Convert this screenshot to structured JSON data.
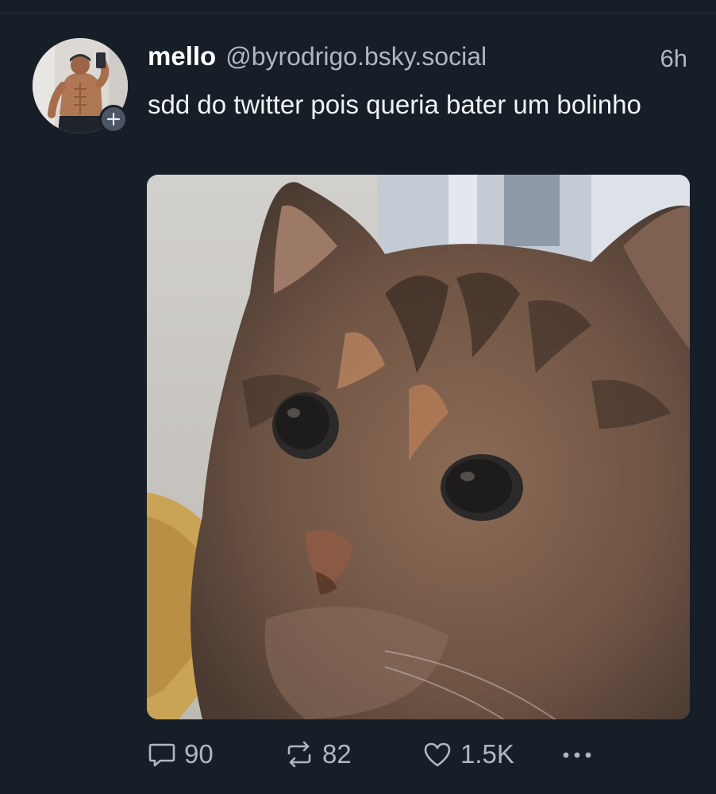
{
  "post": {
    "author": {
      "display_name": "mello",
      "handle": "@byrodrigo.bsky.social",
      "avatar_icon": "profile-photo",
      "follow_icon": "plus-icon"
    },
    "timestamp": "6h",
    "text": "sdd do twitter pois queria bater um bolinho",
    "media": {
      "kind": "image",
      "subject": "tabby-cat-closeup"
    },
    "actions": {
      "reply": {
        "icon": "speech-bubble-icon",
        "count": "90"
      },
      "repost": {
        "icon": "repost-arrows-icon",
        "count": "82"
      },
      "like": {
        "icon": "heart-icon",
        "count": "1.5K"
      },
      "more": {
        "icon": "ellipsis-icon"
      }
    }
  },
  "colors": {
    "background": "#161e27",
    "primary_text": "#ffffff",
    "secondary_text": "#aeb8c4"
  }
}
